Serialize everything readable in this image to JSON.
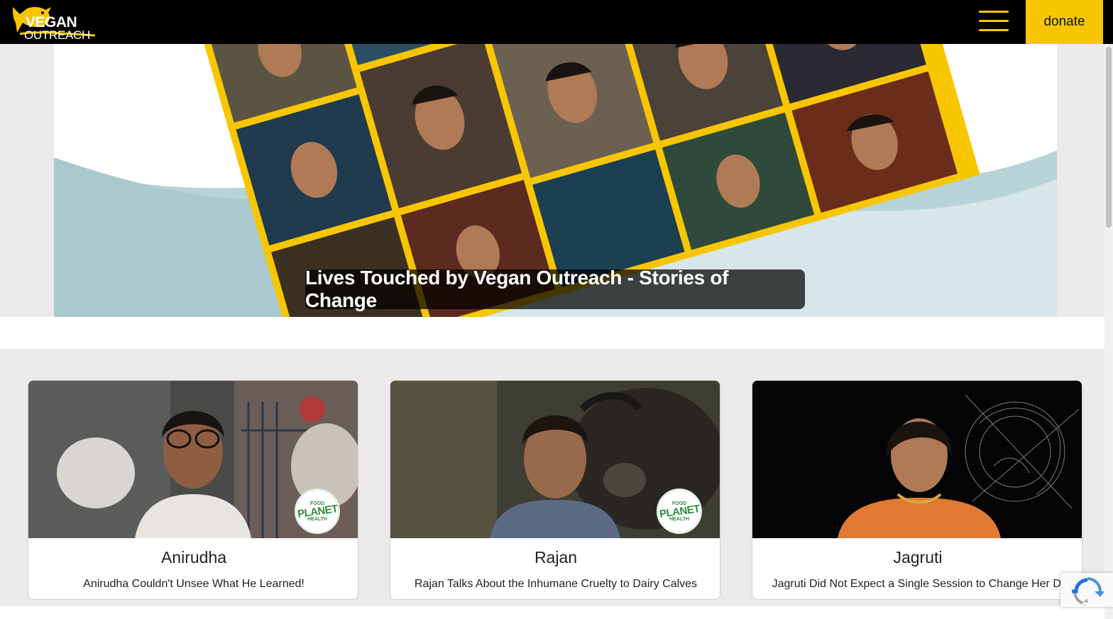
{
  "header": {
    "logo_line1": "VEGAN",
    "logo_line2": "OUTREACH",
    "logo_icon": "chick-logo-icon",
    "menu_icon": "hamburger-menu-icon",
    "donate_label": "donate"
  },
  "colors": {
    "brand_yellow": "#f7c600",
    "header_bg": "#000000",
    "page_bg": "#ebe9ea",
    "badge_green": "#2e8b3e"
  },
  "hero": {
    "caption": "Lives Touched by Vegan Outreach - Stories of Change"
  },
  "cards": [
    {
      "name": "Anirudha",
      "description": "Anirudha Couldn't Unsee What He Learned!",
      "badge": {
        "top": "FOOD",
        "main": "PLANET",
        "bottom": "HEALTH"
      }
    },
    {
      "name": "Rajan",
      "description": "Rajan Talks About the Inhumane Cruelty to Dairy Calves",
      "badge": {
        "top": "FOOD",
        "main": "PLANET",
        "bottom": "HEALTH"
      }
    },
    {
      "name": "Jagruti",
      "description": "Jagruti Did Not Expect a Single Session to Change Her Di"
    }
  ]
}
